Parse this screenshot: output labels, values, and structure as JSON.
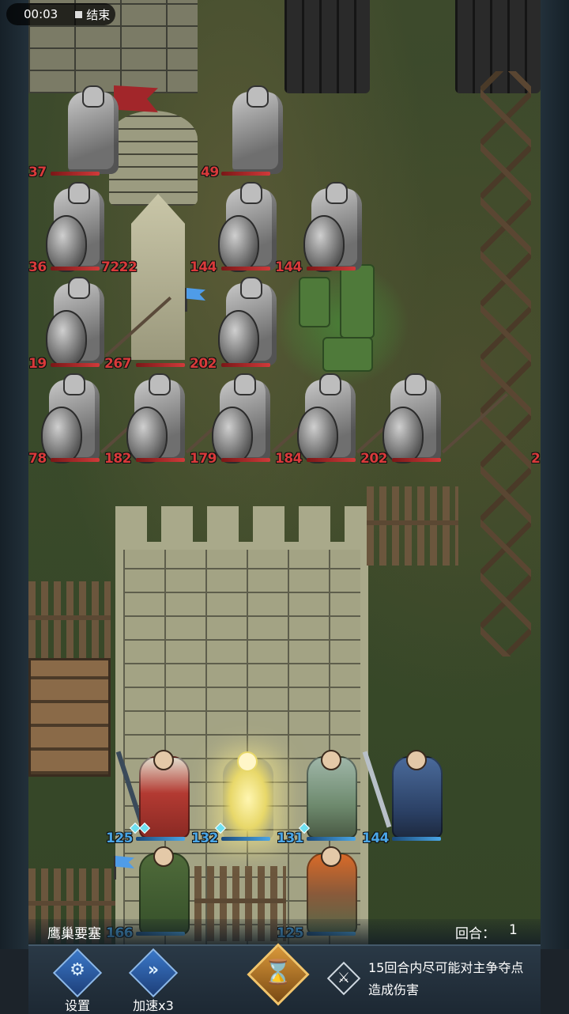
{
  "status": {
    "clock": "00:03",
    "end_label": "结束"
  },
  "enemies": [
    {
      "id": "crossbow-1",
      "hp": "37"
    },
    {
      "id": "crossbow-2",
      "hp": "49"
    },
    {
      "id": "row2-1",
      "hp": "36"
    },
    {
      "id": "tower",
      "hp": "7222"
    },
    {
      "id": "row2-3",
      "hp": "144"
    },
    {
      "id": "row2-4",
      "hp": "144"
    },
    {
      "id": "row3-1",
      "hp": "19"
    },
    {
      "id": "monolith",
      "hp": "267"
    },
    {
      "id": "row3-3",
      "hp": "202"
    },
    {
      "id": "row4-1",
      "hp": "78"
    },
    {
      "id": "row4-2",
      "hp": "182"
    },
    {
      "id": "row4-3",
      "hp": "179"
    },
    {
      "id": "row4-4",
      "hp": "184"
    },
    {
      "id": "row4-5",
      "hp": "202"
    },
    {
      "id": "row4-edge",
      "hp": "2"
    }
  ],
  "allies": [
    {
      "id": "mage",
      "hp": "125"
    },
    {
      "id": "glowing-archer",
      "hp": "132"
    },
    {
      "id": "bard",
      "hp": "131"
    },
    {
      "id": "swordsman",
      "hp": "144"
    },
    {
      "id": "ranger",
      "hp": "166"
    },
    {
      "id": "fire-guitarist",
      "hp": "125"
    }
  ],
  "hud": {
    "map_name": "鹰巢要塞",
    "round_label": "回合：",
    "round_value": "1",
    "settings_label": "设置",
    "speed_label": "加速x3",
    "objective_line1": "15回合内尽可能对主争夺点",
    "objective_line2": "造成伤害"
  },
  "colors": {
    "enemy_hp": "#d83a3a",
    "ally_hp": "#4aa6e6",
    "accent": "#e2a848"
  },
  "icons": {
    "settings": "gear-icon",
    "speed": "fast-forward-icon",
    "end_turn": "hourglass-icon",
    "objective": "sword-crossed-icon"
  }
}
